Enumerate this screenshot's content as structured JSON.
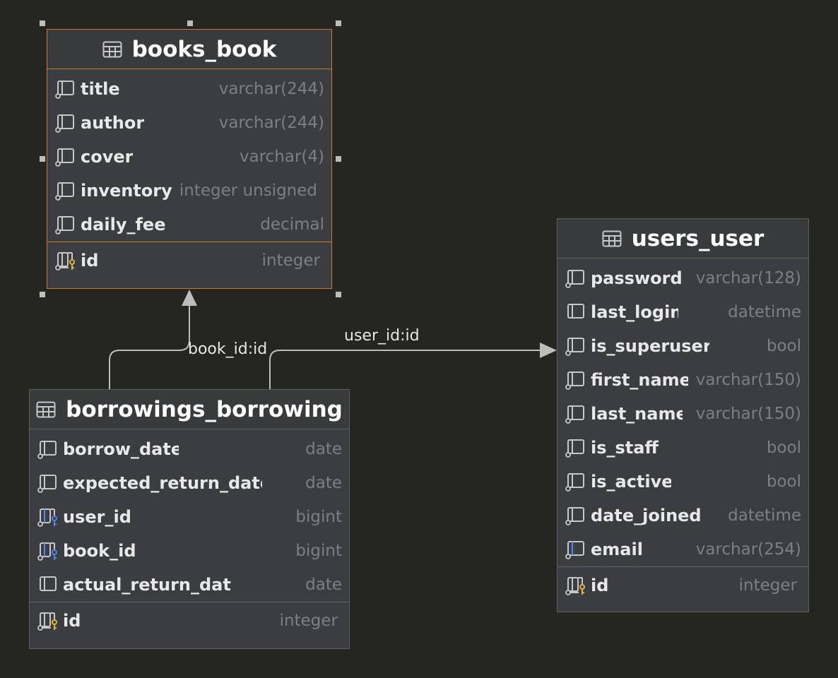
{
  "tables": {
    "books": {
      "name": "books_book",
      "columns": [
        {
          "name": "title",
          "type": "varchar(244)"
        },
        {
          "name": "author",
          "type": "varchar(244)"
        },
        {
          "name": "cover",
          "type": "varchar(4)"
        },
        {
          "name": "inventory",
          "type": "integer unsigned"
        },
        {
          "name": "daily_fee",
          "type": "decimal"
        }
      ],
      "pk": {
        "name": "id",
        "type": "integer"
      }
    },
    "users": {
      "name": "users_user",
      "columns": [
        {
          "name": "password",
          "type": "varchar(128)"
        },
        {
          "name": "last_login",
          "type": "datetime"
        },
        {
          "name": "is_superuser",
          "type": "bool"
        },
        {
          "name": "first_name",
          "type": "varchar(150)"
        },
        {
          "name": "last_name",
          "type": "varchar(150)"
        },
        {
          "name": "is_staff",
          "type": "bool"
        },
        {
          "name": "is_active",
          "type": "bool"
        },
        {
          "name": "date_joined",
          "type": "datetime"
        },
        {
          "name": "email",
          "type": "varchar(254)"
        }
      ],
      "pk": {
        "name": "id",
        "type": "integer"
      }
    },
    "borrowings": {
      "name": "borrowings_borrowing",
      "columns": [
        {
          "name": "borrow_date",
          "type": "date"
        },
        {
          "name": "expected_return_date",
          "type": "date"
        },
        {
          "name": "user_id",
          "type": "bigint"
        },
        {
          "name": "book_id",
          "type": "bigint"
        },
        {
          "name": "actual_return_date",
          "type": "date"
        }
      ],
      "pk": {
        "name": "id",
        "type": "integer"
      }
    }
  },
  "relations": {
    "book": "book_id:id",
    "user": "user_id:id"
  },
  "icons": {
    "table": "table-icon",
    "column": "column-icon",
    "nullable_column": "nullable-column-icon",
    "foreign_key": "foreign-key-column-icon",
    "unique_column": "unique-column-icon",
    "primary_key": "primary-key-column-icon"
  },
  "colors": {
    "canvas": "#262621",
    "table_body": "#3b3d40",
    "selected_border": "#c77a35",
    "primary_key": "#e0b341",
    "foreign_key": "#4f86e8",
    "connector": "#bdbdbd"
  }
}
